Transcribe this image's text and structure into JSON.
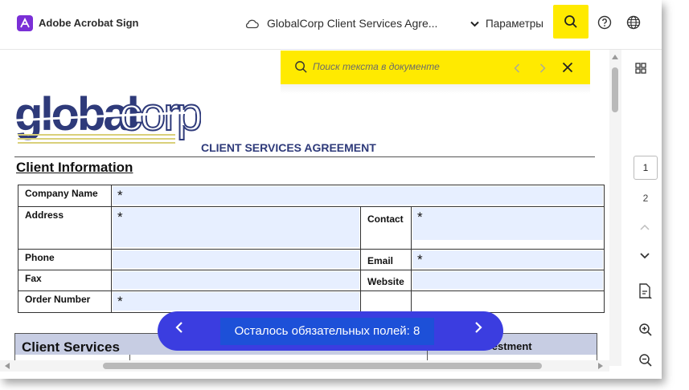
{
  "header": {
    "brand": "Adobe Acrobat Sign",
    "doc_title": "GlobalCorp Client Services Agre...",
    "params_label": "Параметры"
  },
  "search": {
    "placeholder": "Поиск текста в документе"
  },
  "document": {
    "logo_text_1": "global",
    "logo_text_2": "corp",
    "title": "CLIENT SERVICES AGREEMENT",
    "section_client_info": "Client Information",
    "labels": {
      "company_name": "Company Name",
      "address": "Address",
      "contact": "Contact",
      "phone": "Phone",
      "email": "Email",
      "fax": "Fax",
      "website": "Website",
      "order_number": "Order Number"
    },
    "required_mark": "*",
    "section_services": "Client Services",
    "investment_label": "Investment"
  },
  "required_nav": {
    "text": "Осталось обязательных полей: 8",
    "prev": "‹",
    "next": "›"
  },
  "rail": {
    "current_page": "1",
    "next_page": "2"
  },
  "colors": {
    "highlight_yellow": "#ffea00",
    "required_pill": "#3b3de0",
    "field_fill": "#e7efff",
    "brand_purple": "#7a2fd6"
  }
}
